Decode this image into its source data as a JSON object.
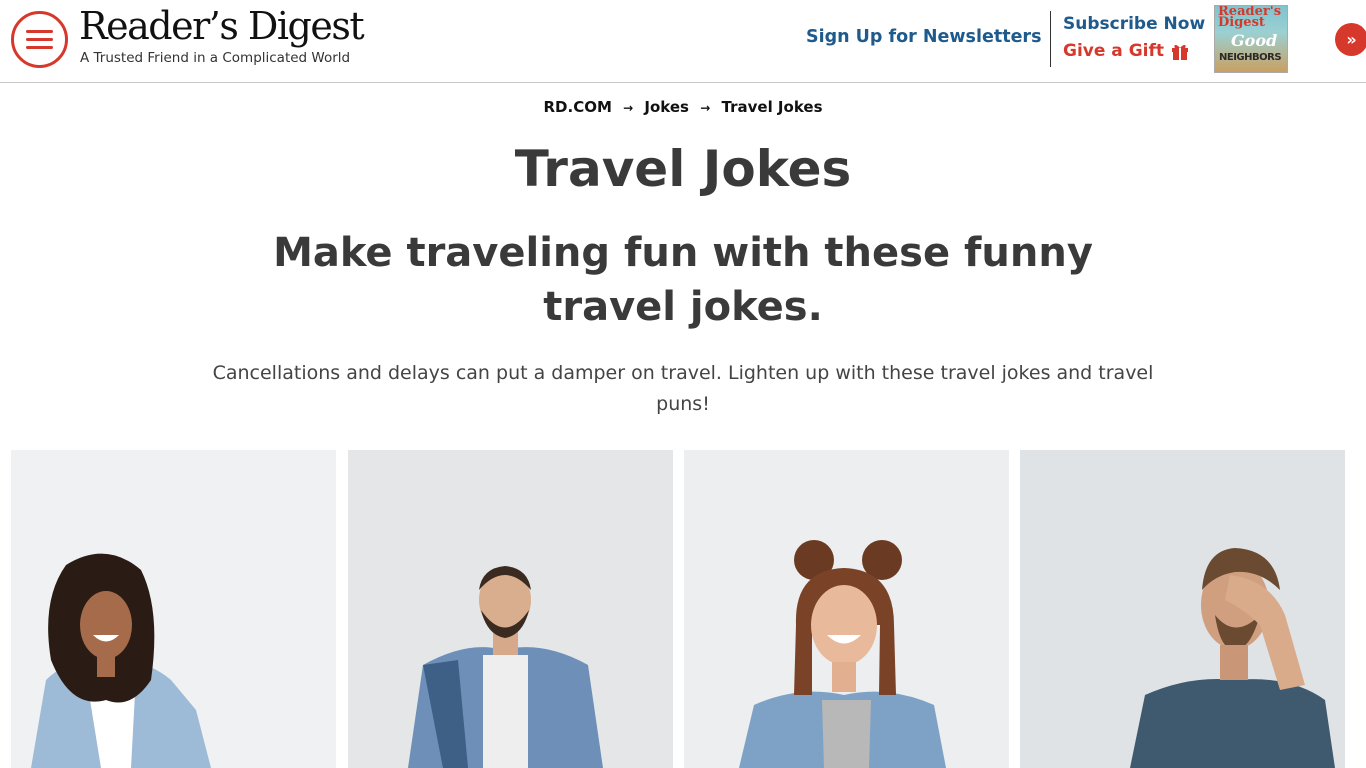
{
  "header": {
    "logo_title": "Reader’s Digest",
    "logo_tagline": "A Trusted Friend in a Complicated World",
    "newsletter_label": "Sign Up for Newsletters",
    "subscribe_label": "Subscribe Now",
    "gift_label": "Give a Gift",
    "magazine": {
      "title_line1": "Reader's",
      "title_line2": "Digest",
      "cover_word1": "Good",
      "cover_word2": "NEIGHBORS"
    },
    "next_label": "»"
  },
  "breadcrumb": {
    "items": [
      "RD.COM",
      "Jokes",
      "Travel Jokes"
    ],
    "separator": "→"
  },
  "page": {
    "title": "Travel Jokes",
    "subtitle": "Make traveling fun with these funny travel jokes.",
    "intro": "Cancellations and delays can put a damper on travel. Lighten up with these travel jokes and travel puns!"
  },
  "cards": [
    {
      "icon": "laughing-woman-photo"
    },
    {
      "icon": "laughing-man-photo"
    },
    {
      "icon": "laughing-woman-buns-photo"
    },
    {
      "icon": "facepalm-man-photo"
    }
  ],
  "colors": {
    "brand_red": "#d6392c",
    "link_blue": "#1e5a8c",
    "heading": "#3a3a3a"
  }
}
